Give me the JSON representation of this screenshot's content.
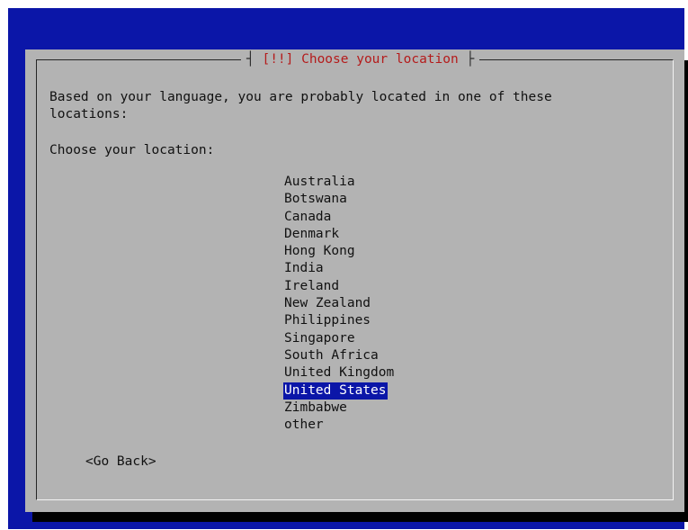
{
  "dialog": {
    "title": "[!!] Choose your location",
    "intro_line1": "Based on your language, you are probably located in one of these",
    "intro_line2": "locations:",
    "prompt": "Choose your location:",
    "locations": [
      "Australia",
      "Botswana",
      "Canada",
      "Denmark",
      "Hong Kong",
      "India",
      "Ireland",
      "New Zealand",
      "Philippines",
      "Singapore",
      "South Africa",
      "United Kingdom",
      "United States",
      "Zimbabwe",
      "other"
    ],
    "selected_location": "United States",
    "back_label": "<Go Back>"
  },
  "colors": {
    "screen_background": "#0b16a8",
    "dialog_background": "#b3b3b3",
    "title_color": "#b41b1b",
    "selection_background": "#0b16a8",
    "selection_text": "#ffffff"
  }
}
